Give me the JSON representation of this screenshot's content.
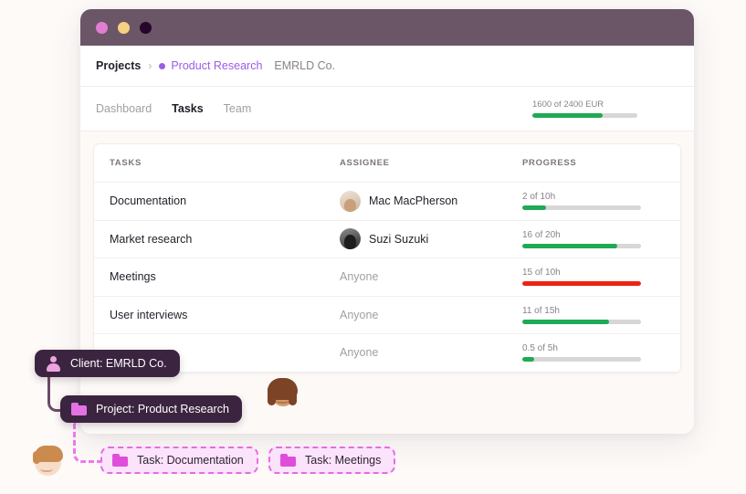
{
  "window": {
    "dots": [
      {
        "name": "pink-dot",
        "color": "#e07fd1"
      },
      {
        "name": "yellow-dot",
        "color": "#f7d182"
      },
      {
        "name": "dark-dot",
        "color": "#24072a"
      }
    ]
  },
  "breadcrumb": {
    "root": "Projects",
    "separator": "›",
    "project": "Product Research",
    "client": "EMRLD Co.",
    "project_dot_color": "#9b5de5"
  },
  "tabs": [
    {
      "label": "Dashboard",
      "active": false
    },
    {
      "label": "Tasks",
      "active": true
    },
    {
      "label": "Team",
      "active": false
    }
  ],
  "budget": {
    "label": "1600 of 2400 EUR",
    "percent": 67,
    "color": "#1faa55"
  },
  "table": {
    "headers": {
      "tasks": "TASKS",
      "assignee": "ASSIGNEE",
      "progress": "PROGRESS"
    },
    "rows": [
      {
        "task": "Documentation",
        "assignee": "Mac MacPherson",
        "has_avatar": true,
        "progress_label": "2 of 10h",
        "percent": 20,
        "over": false
      },
      {
        "task": "Market research",
        "assignee": "Suzi Suzuki",
        "has_avatar": true,
        "progress_label": "16 of 20h",
        "percent": 80,
        "over": false
      },
      {
        "task": "Meetings",
        "assignee": "Anyone",
        "has_avatar": false,
        "progress_label": "15 of 10h",
        "percent": 100,
        "over": true
      },
      {
        "task": "User interviews",
        "assignee": "Anyone",
        "has_avatar": false,
        "progress_label": "11 of 15h",
        "percent": 73,
        "over": false
      },
      {
        "task": "",
        "assignee": "Anyone",
        "has_avatar": false,
        "progress_label": "0.5 of 5h",
        "percent": 10,
        "over": false
      }
    ]
  },
  "diagram": {
    "client_chip": "Client: EMRLD Co.",
    "project_chip": "Project: Product Research",
    "task_chip_1": "Task: Documentation",
    "task_chip_2": "Task: Meetings",
    "solid_chip_color": "#3b2440",
    "dashed_chip_bg": "#fbe3fb",
    "dashed_chip_border": "#e66be6"
  }
}
